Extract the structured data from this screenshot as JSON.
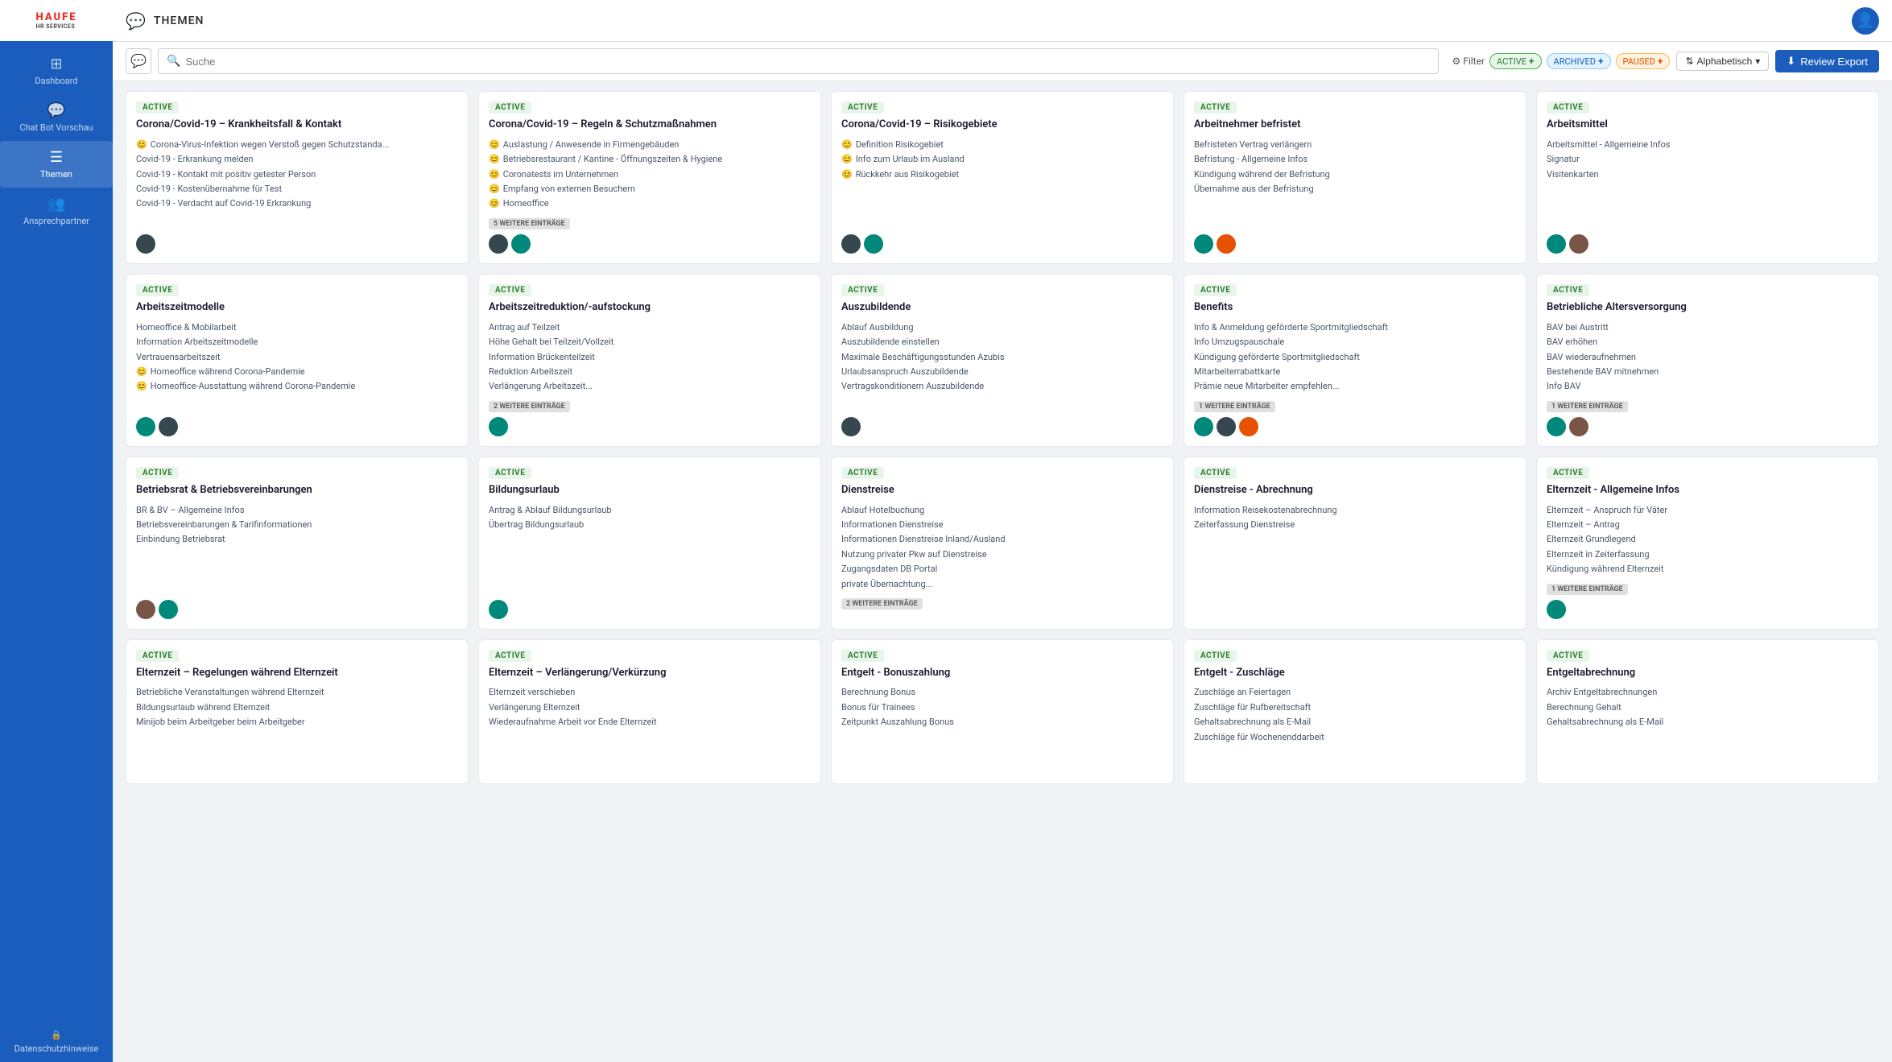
{
  "sidebar": {
    "logo": {
      "main": "HAUFE",
      "sub": "HR SERVICES"
    },
    "items": [
      {
        "id": "dashboard",
        "label": "Dashboard",
        "icon": "⊞"
      },
      {
        "id": "chatbot",
        "label": "Chat Bot Vorschau",
        "icon": "💬"
      },
      {
        "id": "themen",
        "label": "Themen",
        "icon": "☰",
        "active": true
      },
      {
        "id": "ansprechpartner",
        "label": "Ansprechpartner",
        "icon": "👥"
      }
    ],
    "bottom": {
      "label": "Datenschutzhinweise",
      "icon": "🔒"
    }
  },
  "topbar": {
    "icon": "💬",
    "title": "THEMEN"
  },
  "toolbar": {
    "search_placeholder": "Suche",
    "filter_label": "Filter",
    "chips": [
      {
        "id": "active",
        "label": "ACTIVE",
        "class": "active-chip"
      },
      {
        "id": "archived",
        "label": "ARCHIVED",
        "class": "archived-chip"
      },
      {
        "id": "paused",
        "label": "PAUSED",
        "class": "paused-chip"
      }
    ],
    "sort_label": "Alphabetisch",
    "review_export_label": "Review Export",
    "download_icon": "⬇"
  },
  "cards": [
    {
      "status": "ACTIVE",
      "title": "Corona/Covid-19 – Krankheitsfall & Kontakt",
      "items": [
        {
          "emoji": "😊",
          "text": "Corona-Virus-Infektion wegen Verstoß gegen Schutzstanda..."
        },
        {
          "emoji": "",
          "text": "Covid-19 - Erkrankung melden"
        },
        {
          "emoji": "",
          "text": "Covid-19 - Kontakt mit positiv getester Person"
        },
        {
          "emoji": "",
          "text": "Covid-19 - Kostenübernahme für Test"
        },
        {
          "emoji": "",
          "text": "Covid-19 - Verdacht auf Covid-19 Erkrankung"
        }
      ],
      "more": null,
      "avatars": [
        "dark"
      ]
    },
    {
      "status": "ACTIVE",
      "title": "Corona/Covid-19 – Regeln & Schutzmaßnahmen",
      "items": [
        {
          "emoji": "😊",
          "text": "Auslastung / Anwesende in Firmengebäuden"
        },
        {
          "emoji": "😊",
          "text": "Betriebsrestaurant / Kantine - Öffnungszeiten & Hygiene"
        },
        {
          "emoji": "😊",
          "text": "Coronatests im Unternehmen"
        },
        {
          "emoji": "😊",
          "text": "Empfang von externen Besuchern"
        },
        {
          "emoji": "😊",
          "text": "Homeoffice"
        }
      ],
      "more": "5 WEITERE EINTRÄGE",
      "avatars": [
        "dark",
        "teal"
      ]
    },
    {
      "status": "ACTIVE",
      "title": "Corona/Covid-19 – Risikogebiete",
      "items": [
        {
          "emoji": "😊",
          "text": "Definition Risikogebiet"
        },
        {
          "emoji": "😊",
          "text": "Info zum Urlaub im Ausland"
        },
        {
          "emoji": "😊",
          "text": "Rückkehr aus Risikogebiet"
        }
      ],
      "more": null,
      "avatars": [
        "dark",
        "teal"
      ]
    },
    {
      "status": "ACTIVE",
      "title": "Arbeitnehmer befristet",
      "items": [
        {
          "emoji": "",
          "text": "Befristeten Vertrag verlängern"
        },
        {
          "emoji": "",
          "text": "Befristung - Allgemeine Infos"
        },
        {
          "emoji": "",
          "text": "Kündigung während der Befristung"
        },
        {
          "emoji": "",
          "text": "Übernahme aus der Befristung"
        }
      ],
      "more": null,
      "avatars": [
        "teal",
        "orange"
      ]
    },
    {
      "status": "ACTIVE",
      "title": "Arbeitsmittel",
      "items": [
        {
          "emoji": "",
          "text": "Arbeitsmittel - Allgemeine Infos"
        },
        {
          "emoji": "",
          "text": "Signatur"
        },
        {
          "emoji": "",
          "text": "Visitenkarten"
        }
      ],
      "more": null,
      "avatars": [
        "teal",
        "brown"
      ]
    },
    {
      "status": "ACTIVE",
      "title": "Arbeitszeitmodelle",
      "items": [
        {
          "emoji": "",
          "text": "Homeoffice & Mobilarbeit"
        },
        {
          "emoji": "",
          "text": "Information Arbeitszeitmodelle"
        },
        {
          "emoji": "",
          "text": "Vertrauensarbeitszeit"
        },
        {
          "emoji": "😊",
          "text": "Homeoffice während Corona-Pandemie"
        },
        {
          "emoji": "😊",
          "text": "Homeoffice-Ausstattung während Corona-Pandemie"
        }
      ],
      "more": null,
      "avatars": [
        "teal",
        "dark"
      ]
    },
    {
      "status": "ACTIVE",
      "title": "Arbeitszeitreduktion/-aufstockung",
      "items": [
        {
          "emoji": "",
          "text": "Antrag auf Teilzeit"
        },
        {
          "emoji": "",
          "text": "Höhe Gehalt bei Teilzeit/Vollzeit"
        },
        {
          "emoji": "",
          "text": "Information Brückenteilzeit"
        },
        {
          "emoji": "",
          "text": "Reduktion Arbeitszeit"
        },
        {
          "emoji": "",
          "text": "Verlängerung Arbeitszeit..."
        }
      ],
      "more": "2 WEITERE EINTRÄGE",
      "avatars": [
        "teal"
      ]
    },
    {
      "status": "ACTIVE",
      "title": "Auszubildende",
      "items": [
        {
          "emoji": "",
          "text": "Ablauf Ausbildung"
        },
        {
          "emoji": "",
          "text": "Auszubildende einstellen"
        },
        {
          "emoji": "",
          "text": "Maximale Beschäftigungsstunden Azubis"
        },
        {
          "emoji": "",
          "text": "Urlaubsanspruch Auszubildende"
        },
        {
          "emoji": "",
          "text": "Vertragskonditionem Auszubildende"
        }
      ],
      "more": null,
      "avatars": [
        "dark"
      ]
    },
    {
      "status": "ACTIVE",
      "title": "Benefits",
      "items": [
        {
          "emoji": "",
          "text": "Info & Anmeldung geförderte Sportmitgliedschaft"
        },
        {
          "emoji": "",
          "text": "Info Umzugspauschale"
        },
        {
          "emoji": "",
          "text": "Kündigung geförderte Sportmitgliedschaft"
        },
        {
          "emoji": "",
          "text": "Mitarbeiterrabattkarte"
        },
        {
          "emoji": "",
          "text": "Prämie neue Mitarbeiter empfehlen..."
        }
      ],
      "more": "1 WEITERE EINTRÄGE",
      "avatars": [
        "teal",
        "dark",
        "orange"
      ]
    },
    {
      "status": "ACTIVE",
      "title": "Betriebliche Altersversorgung",
      "items": [
        {
          "emoji": "",
          "text": "BAV bei Austritt"
        },
        {
          "emoji": "",
          "text": "BAV erhöhen"
        },
        {
          "emoji": "",
          "text": "BAV wiederaufnehmen"
        },
        {
          "emoji": "",
          "text": "Bestehende BAV mitnehmen"
        },
        {
          "emoji": "",
          "text": "Info BAV"
        }
      ],
      "more": "1 WEITERE EINTRÄGE",
      "avatars": [
        "teal",
        "brown"
      ]
    },
    {
      "status": "ACTIVE",
      "title": "Betriebsrat & Betriebsvereinbarungen",
      "items": [
        {
          "emoji": "",
          "text": "BR & BV – Allgemeine Infos"
        },
        {
          "emoji": "",
          "text": "Betriebsvereinbarungen & Tarifinformationen"
        },
        {
          "emoji": "",
          "text": "Einbindung Betriebsrat"
        }
      ],
      "more": null,
      "avatars": [
        "brown",
        "teal"
      ]
    },
    {
      "status": "ACTIVE",
      "title": "Bildungsurlaub",
      "items": [
        {
          "emoji": "",
          "text": "Antrag & Ablauf Bildungsurlaub"
        },
        {
          "emoji": "",
          "text": "Übertrag Bildungsurlaub"
        }
      ],
      "more": null,
      "avatars": [
        "teal"
      ]
    },
    {
      "status": "ACTIVE",
      "title": "Dienstreise",
      "items": [
        {
          "emoji": "",
          "text": "Ablauf Hotelbuchung"
        },
        {
          "emoji": "",
          "text": "Informationen Dienstreise"
        },
        {
          "emoji": "",
          "text": "Informationen Dienstreise Inland/Ausland"
        },
        {
          "emoji": "",
          "text": "Nutzung privater Pkw auf Dienstreise"
        },
        {
          "emoji": "",
          "text": "Zugangsdaten DB Portal"
        },
        {
          "emoji": "",
          "text": "private Übernachtung..."
        }
      ],
      "more": "2 WEITERE EINTRÄGE",
      "avatars": []
    },
    {
      "status": "ACTIVE",
      "title": "Dienstreise - Abrechnung",
      "items": [
        {
          "emoji": "",
          "text": "Information Reisekostenabrechnung"
        },
        {
          "emoji": "",
          "text": "Zeiterfassung Dienstreise"
        }
      ],
      "more": null,
      "avatars": []
    },
    {
      "status": "ACTIVE",
      "title": "Elternzeit - Allgemeine Infos",
      "items": [
        {
          "emoji": "",
          "text": "Elternzeit – Anspruch für Väter"
        },
        {
          "emoji": "",
          "text": "Elternzeit – Antrag"
        },
        {
          "emoji": "",
          "text": "Elternzeit Grundlegend"
        },
        {
          "emoji": "",
          "text": "Elternzeit in Zeiterfassung"
        },
        {
          "emoji": "",
          "text": "Kündigung während Elternzeit"
        }
      ],
      "more": "1 WEITERE EINTRÄGE",
      "avatars": [
        "teal"
      ]
    },
    {
      "status": "ACTIVE",
      "title": "Elternzeit – Regelungen während Elternzeit",
      "items": [
        {
          "emoji": "",
          "text": "Betriebliche Veranstaltungen während Elternzeit"
        },
        {
          "emoji": "",
          "text": "Bildungsurlaub während Elternzeit"
        },
        {
          "emoji": "",
          "text": "Minijob beim Arbeitgeber beim Arbeitgeber"
        }
      ],
      "more": null,
      "avatars": []
    },
    {
      "status": "ACTIVE",
      "title": "Elternzeit – Verlängerung/Verkürzung",
      "items": [
        {
          "emoji": "",
          "text": "Elternzeit verschieben"
        },
        {
          "emoji": "",
          "text": "Verlängerung Elternzeit"
        },
        {
          "emoji": "",
          "text": "Wiederaufnahme Arbeit vor Ende Elternzeit"
        }
      ],
      "more": null,
      "avatars": []
    },
    {
      "status": "ACTIVE",
      "title": "Entgelt - Bonuszahlung",
      "items": [
        {
          "emoji": "",
          "text": "Berechnung Bonus"
        },
        {
          "emoji": "",
          "text": "Bonus für Trainees"
        },
        {
          "emoji": "",
          "text": "Zeitpunkt Auszahlung Bonus"
        }
      ],
      "more": null,
      "avatars": []
    },
    {
      "status": "ACTIVE",
      "title": "Entgelt - Zuschläge",
      "items": [
        {
          "emoji": "",
          "text": "Zuschläge an Feiertagen"
        },
        {
          "emoji": "",
          "text": "Zuschläge für Rufbereitschaft"
        },
        {
          "emoji": "",
          "text": "Gehaltsabrechnung als E-Mail"
        },
        {
          "emoji": "",
          "text": "Zuschläge für Wochenenddarbeit"
        }
      ],
      "more": null,
      "avatars": []
    },
    {
      "status": "ACTIVE",
      "title": "Entgeltabrechnung",
      "items": [
        {
          "emoji": "",
          "text": "Archiv Entgeltabrechnungen"
        },
        {
          "emoji": "",
          "text": "Berechnung Gehalt"
        },
        {
          "emoji": "",
          "text": "Gehaltsabrechnung als E-Mail"
        }
      ],
      "more": null,
      "avatars": []
    }
  ]
}
